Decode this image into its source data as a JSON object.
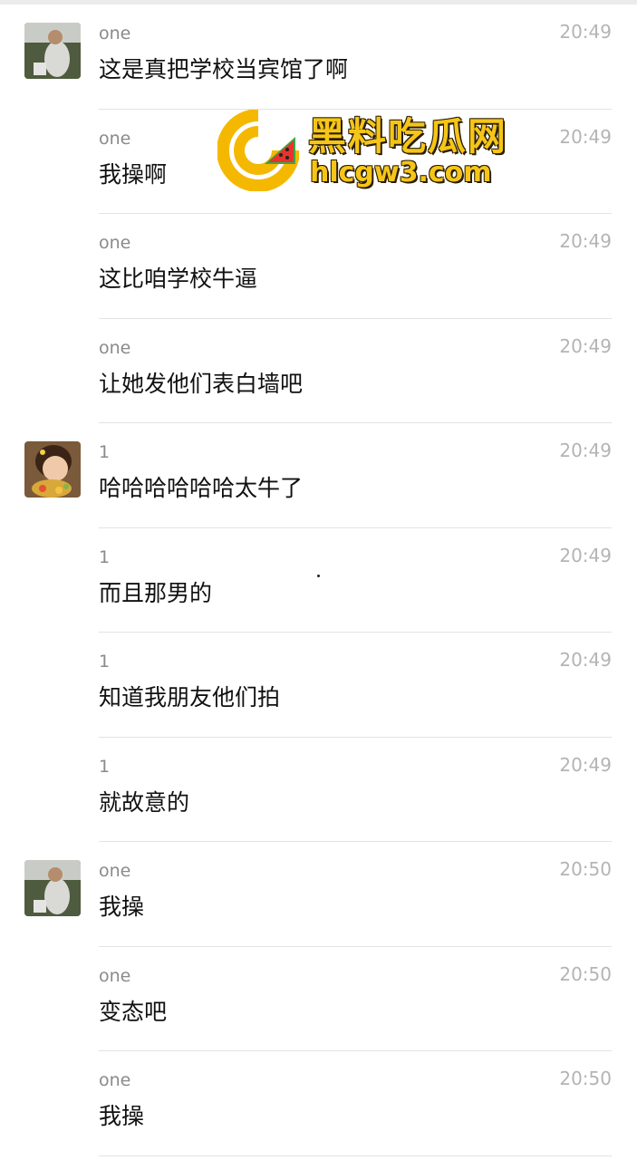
{
  "watermark": {
    "title": "黑料吃瓜网",
    "domain": "hlcgw3.com"
  },
  "messages": [
    {
      "sender": "one",
      "time": "20:49",
      "text": "这是真把学校当宾馆了啊",
      "avatar": "one"
    },
    {
      "sender": "one",
      "time": "20:49",
      "text": "我操啊"
    },
    {
      "sender": "one",
      "time": "20:49",
      "text": "这比咱学校牛逼"
    },
    {
      "sender": "one",
      "time": "20:49",
      "text": "让她发他们表白墙吧"
    },
    {
      "sender": "1",
      "time": "20:49",
      "text": "哈哈哈哈哈哈太牛了",
      "avatar": "1"
    },
    {
      "sender": "1",
      "time": "20:49",
      "text": "而且那男的"
    },
    {
      "sender": "1",
      "time": "20:49",
      "text": "知道我朋友他们拍"
    },
    {
      "sender": "1",
      "time": "20:49",
      "text": "就故意的"
    },
    {
      "sender": "one",
      "time": "20:50",
      "text": "我操",
      "avatar": "one"
    },
    {
      "sender": "one",
      "time": "20:50",
      "text": "变态吧"
    },
    {
      "sender": "one",
      "time": "20:50",
      "text": "我操"
    }
  ]
}
